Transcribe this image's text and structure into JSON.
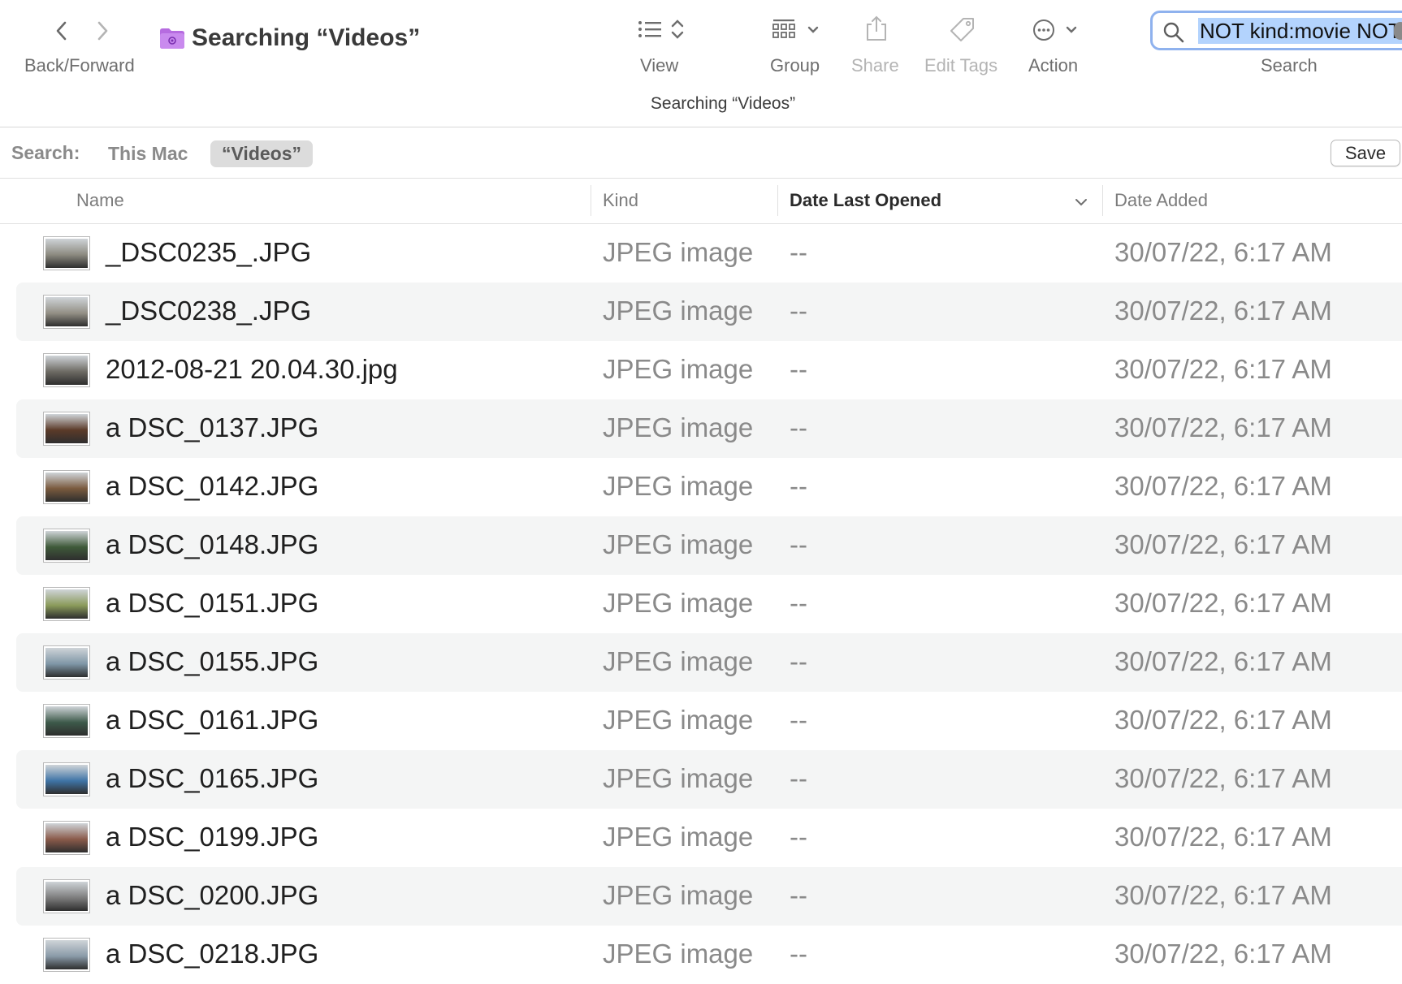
{
  "toolbar": {
    "nav_label": "Back/Forward",
    "window_title": "Searching “Videos”",
    "subtitle": "Searching “Videos”",
    "view_label": "View",
    "group_label": "Group",
    "share_label": "Share",
    "edit_tags_label": "Edit Tags",
    "action_label": "Action",
    "search_label": "Search",
    "search_value": "NOT kind:movie NOT kind:image"
  },
  "scope_bar": {
    "label": "Search:",
    "this_mac": "This Mac",
    "videos": "“Videos”",
    "save": "Save"
  },
  "columns": {
    "name": "Name",
    "kind": "Kind",
    "date_last_opened": "Date Last Opened",
    "date_added": "Date Added"
  },
  "rows": [
    {
      "name": "_DSC0235_.JPG",
      "kind": "JPEG image",
      "opened": "--",
      "added": "30/07/22, 6:17 AM",
      "thumb_color": "#8c8a80"
    },
    {
      "name": "_DSC0238_.JPG",
      "kind": "JPEG image",
      "opened": "--",
      "added": "30/07/22, 6:17 AM",
      "thumb_color": "#938f85"
    },
    {
      "name": "2012-08-21 20.04.30.jpg",
      "kind": "JPEG image",
      "opened": "--",
      "added": "30/07/22, 6:17 AM",
      "thumb_color": "#6d6a63"
    },
    {
      "name": "a DSC_0137.JPG",
      "kind": "JPEG image",
      "opened": "--",
      "added": "30/07/22, 6:17 AM",
      "thumb_color": "#5b3a28"
    },
    {
      "name": "a DSC_0142.JPG",
      "kind": "JPEG image",
      "opened": "--",
      "added": "30/07/22, 6:17 AM",
      "thumb_color": "#7a5a3e"
    },
    {
      "name": "a DSC_0148.JPG",
      "kind": "JPEG image",
      "opened": "--",
      "added": "30/07/22, 6:17 AM",
      "thumb_color": "#3f5a3a"
    },
    {
      "name": "a DSC_0151.JPG",
      "kind": "JPEG image",
      "opened": "--",
      "added": "30/07/22, 6:17 AM",
      "thumb_color": "#8a9a5a"
    },
    {
      "name": "a DSC_0155.JPG",
      "kind": "JPEG image",
      "opened": "--",
      "added": "30/07/22, 6:17 AM",
      "thumb_color": "#7f96a6"
    },
    {
      "name": "a DSC_0161.JPG",
      "kind": "JPEG image",
      "opened": "--",
      "added": "30/07/22, 6:17 AM",
      "thumb_color": "#3d5a4a"
    },
    {
      "name": "a DSC_0165.JPG",
      "kind": "JPEG image",
      "opened": "--",
      "added": "30/07/22, 6:17 AM",
      "thumb_color": "#3f74a6"
    },
    {
      "name": "a DSC_0199.JPG",
      "kind": "JPEG image",
      "opened": "--",
      "added": "30/07/22, 6:17 AM",
      "thumb_color": "#8a5a4a"
    },
    {
      "name": "a DSC_0200.JPG",
      "kind": "JPEG image",
      "opened": "--",
      "added": "30/07/22, 6:17 AM",
      "thumb_color": "#7d7d7d"
    },
    {
      "name": "a DSC_0218.JPG",
      "kind": "JPEG image",
      "opened": "--",
      "added": "30/07/22, 6:17 AM",
      "thumb_color": "#8a9aa8"
    }
  ]
}
